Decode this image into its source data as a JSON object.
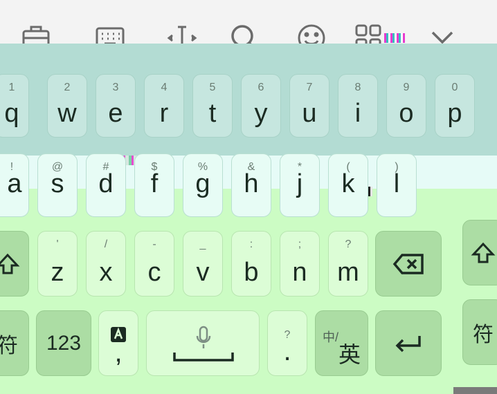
{
  "toolbar": {
    "icons": [
      "briefcase-icon",
      "keyboard-icon",
      "text-cursor-icon",
      "search-icon",
      "emoji-icon",
      "grid-apps-icon",
      "collapse-icon"
    ]
  },
  "rows": {
    "row1": [
      {
        "hint": "1",
        "label": "q"
      },
      {
        "hint": "2",
        "label": "w"
      },
      {
        "hint": "3",
        "label": "e"
      },
      {
        "hint": "4",
        "label": "r"
      },
      {
        "hint": "5",
        "label": "t"
      },
      {
        "hint": "6",
        "label": "y"
      },
      {
        "hint": "7",
        "label": "u"
      },
      {
        "hint": "8",
        "label": "i"
      },
      {
        "hint": "9",
        "label": "o"
      },
      {
        "hint": "0",
        "label": "p"
      }
    ],
    "row2": [
      {
        "hint": "!",
        "label": "a"
      },
      {
        "hint": "@",
        "label": "s"
      },
      {
        "hint": "#",
        "label": "d"
      },
      {
        "hint": "$",
        "label": "f"
      },
      {
        "hint": "%",
        "label": "g"
      },
      {
        "hint": "&",
        "label": "h"
      },
      {
        "hint": "*",
        "label": "j"
      },
      {
        "hint": "(",
        "label": "k"
      },
      {
        "hint": ")",
        "label": "l"
      }
    ],
    "row3": [
      {
        "hint": "'",
        "label": "z"
      },
      {
        "hint": "/",
        "label": "x"
      },
      {
        "hint": "-",
        "label": "c"
      },
      {
        "hint": "_",
        "label": "v"
      },
      {
        "hint": ":",
        "label": "b"
      },
      {
        "hint": ";",
        "label": "n"
      },
      {
        "hint": "?",
        "label": "m"
      }
    ]
  },
  "bottom": {
    "symbols_left": "符",
    "numbers": "123",
    "comma": ",",
    "period_hint": "?",
    "period": ".",
    "lang_small": "中/",
    "lang_big": "英",
    "symbols_right": "符"
  },
  "colors": {
    "toolbar_bg": "#f3f3f3",
    "band1": "#b3dcd3",
    "band2": "#e6fbf7",
    "band3": "#ccfcc4",
    "dark_key": "#acdda4",
    "light_key": "#dcfdd6"
  }
}
